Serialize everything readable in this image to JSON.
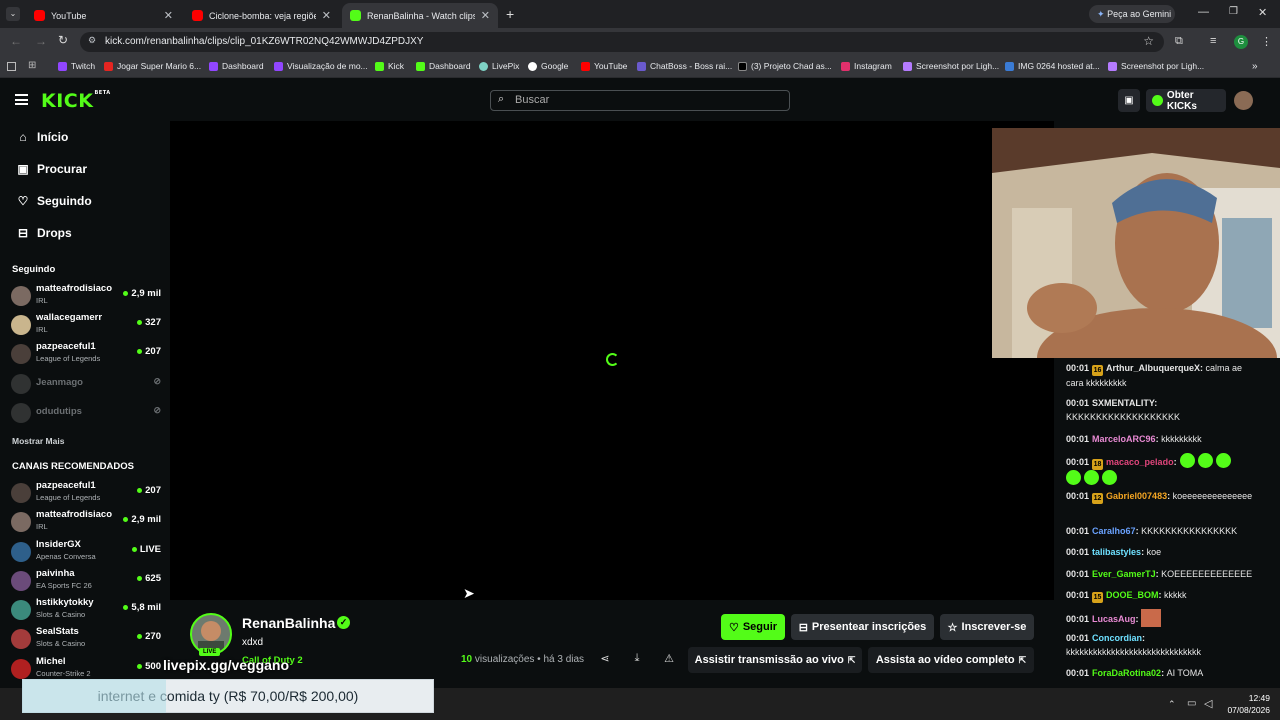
{
  "browser": {
    "tabs": [
      {
        "title": "YouTube",
        "favicon_color": "#ff0000"
      },
      {
        "title": "Ciclone-bomba: veja regiões co",
        "favicon_color": "#ff0000"
      },
      {
        "title": "RenanBalinha - Watch clips on",
        "favicon_color": "#53fc18"
      }
    ],
    "gemini_label": "Peça ao Gemini",
    "url": "kick.com/renanbalinha/clips/clip_01KZ6WTR02NQ42WMWJD4ZPDJXY",
    "profile_initial": "G",
    "bookmarks": [
      "Twitch",
      "Jogar Super Mario 6...",
      "Dashboard",
      "Visualização de mo...",
      "Kick",
      "Dashboard",
      "LivePix",
      "Google",
      "YouTube",
      "ChatBoss - Boss rai...",
      "(3) Projeto Chad as...",
      "Instagram",
      "Screenshot por Ligh...",
      "IMG 0264 hosted at...",
      "Screenshot por Ligh..."
    ]
  },
  "header": {
    "logo": "KICK",
    "logo_badge": "BETA",
    "search_placeholder": "Buscar",
    "kicks_button": "Obter KICKs"
  },
  "sidebar": {
    "nav": [
      {
        "label": "Início",
        "icon": "home-icon"
      },
      {
        "label": "Procurar",
        "icon": "compass-icon"
      },
      {
        "label": "Seguindo",
        "icon": "heart-icon"
      },
      {
        "label": "Drops",
        "icon": "gift-icon"
      }
    ],
    "following_title": "Seguindo",
    "following": [
      {
        "name": "matteafrodisiaco",
        "category": "IRL",
        "viewers": "2,9 mil"
      },
      {
        "name": "wallacegamerr",
        "category": "IRL",
        "viewers": "327"
      },
      {
        "name": "pazpeaceful1",
        "category": "League of Legends",
        "viewers": "207"
      },
      {
        "name": "Jeanmago",
        "category": "",
        "viewers": ""
      },
      {
        "name": "odudutips",
        "category": "",
        "viewers": ""
      }
    ],
    "show_more": "Mostrar Mais",
    "recommended_title": "CANAIS RECOMENDADOS",
    "recommended": [
      {
        "name": "pazpeaceful1",
        "category": "League of Legends",
        "viewers": "207"
      },
      {
        "name": "matteafrodisiaco",
        "category": "IRL",
        "viewers": "2,9 mil"
      },
      {
        "name": "InsiderGX",
        "category": "Apenas Conversa",
        "viewers": "LIVE"
      },
      {
        "name": "paivinha",
        "category": "EA Sports FC 26",
        "viewers": "625"
      },
      {
        "name": "hstikkytokky",
        "category": "Slots & Casino",
        "viewers": "5,8 mil"
      },
      {
        "name": "SealStats",
        "category": "Slots & Casino",
        "viewers": "270"
      },
      {
        "name": "Michel",
        "category": "Counter-Strike 2",
        "viewers": "500"
      }
    ]
  },
  "chat": [
    {
      "time": "00:01",
      "badge": "16",
      "user": "Arthur_AlbuquerqueX",
      "color": "#e6e6e6",
      "text": "calma ae cara kkkkkkkkk"
    },
    {
      "time": "00:01",
      "badge": "",
      "user": "SXMENTALITY",
      "color": "#e6e6e6",
      "text": "KKKKKKKKKKKKKKKKKKK"
    },
    {
      "time": "00:01",
      "badge": "",
      "user": "MarceloARC96",
      "color": "#e88ad3",
      "text": "kkkkkkkkk"
    },
    {
      "time": "00:01",
      "badge": "18",
      "user": "macaco_pelado",
      "color": "#e0457b",
      "text": ""
    },
    {
      "time": "00:01",
      "badge": "12",
      "user": "Gabriel007483",
      "color": "#f5a623",
      "text": "koeeeeeeeeeeeeee"
    },
    {
      "time": "00:01",
      "badge": "",
      "user": "Caralho67",
      "color": "#6aa2ff",
      "text": "KKKKKKKKKKKKKKKK"
    },
    {
      "time": "00:01",
      "badge": "",
      "user": "talibastyles",
      "color": "#6ee0ff",
      "text": "koe"
    },
    {
      "time": "00:01",
      "badge": "",
      "user": "Ever_GamerTJ",
      "color": "#53fc18",
      "text": "KOEEEEEEEEEEEEE"
    },
    {
      "time": "00:01",
      "badge": "15",
      "user": "DOOE_BOM",
      "color": "#53fc18",
      "text": "kkkkk"
    },
    {
      "time": "00:01",
      "badge": "",
      "user": "LucasAug",
      "color": "#e88ad3",
      "text": ""
    },
    {
      "time": "00:01",
      "badge": "",
      "user": "Concordian",
      "color": "#6ee0ff",
      "text": "kkkkkkkkkkkkkkkkkkkkkkkkkkkkkk"
    },
    {
      "time": "00:01",
      "badge": "",
      "user": "ForaDaRotina02",
      "color": "#53fc18",
      "text": "AI TOMA"
    }
  ],
  "clip": {
    "streamer": "RenanBalinha",
    "live_tag": "LIVE",
    "title": "xdxd",
    "category": "Call of Duty 2",
    "overlay_url": "livepix.gg/veggano",
    "views_count": "10",
    "views_label": "visualizações",
    "age": "há 3 dias",
    "follow_button": "Seguir",
    "gift_button": "Presentear inscrições",
    "subscribe_button": "Inscrever-se",
    "watch_live_button": "Assistir transmissão ao vivo",
    "watch_full_button": "Assista ao vídeo completo"
  },
  "alert": {
    "text": "internet e comida ty (R$ 70,00/R$ 200,00)",
    "progress": 0.35
  },
  "taskbar": {
    "time": "12:49",
    "date": "07/08/2026"
  }
}
